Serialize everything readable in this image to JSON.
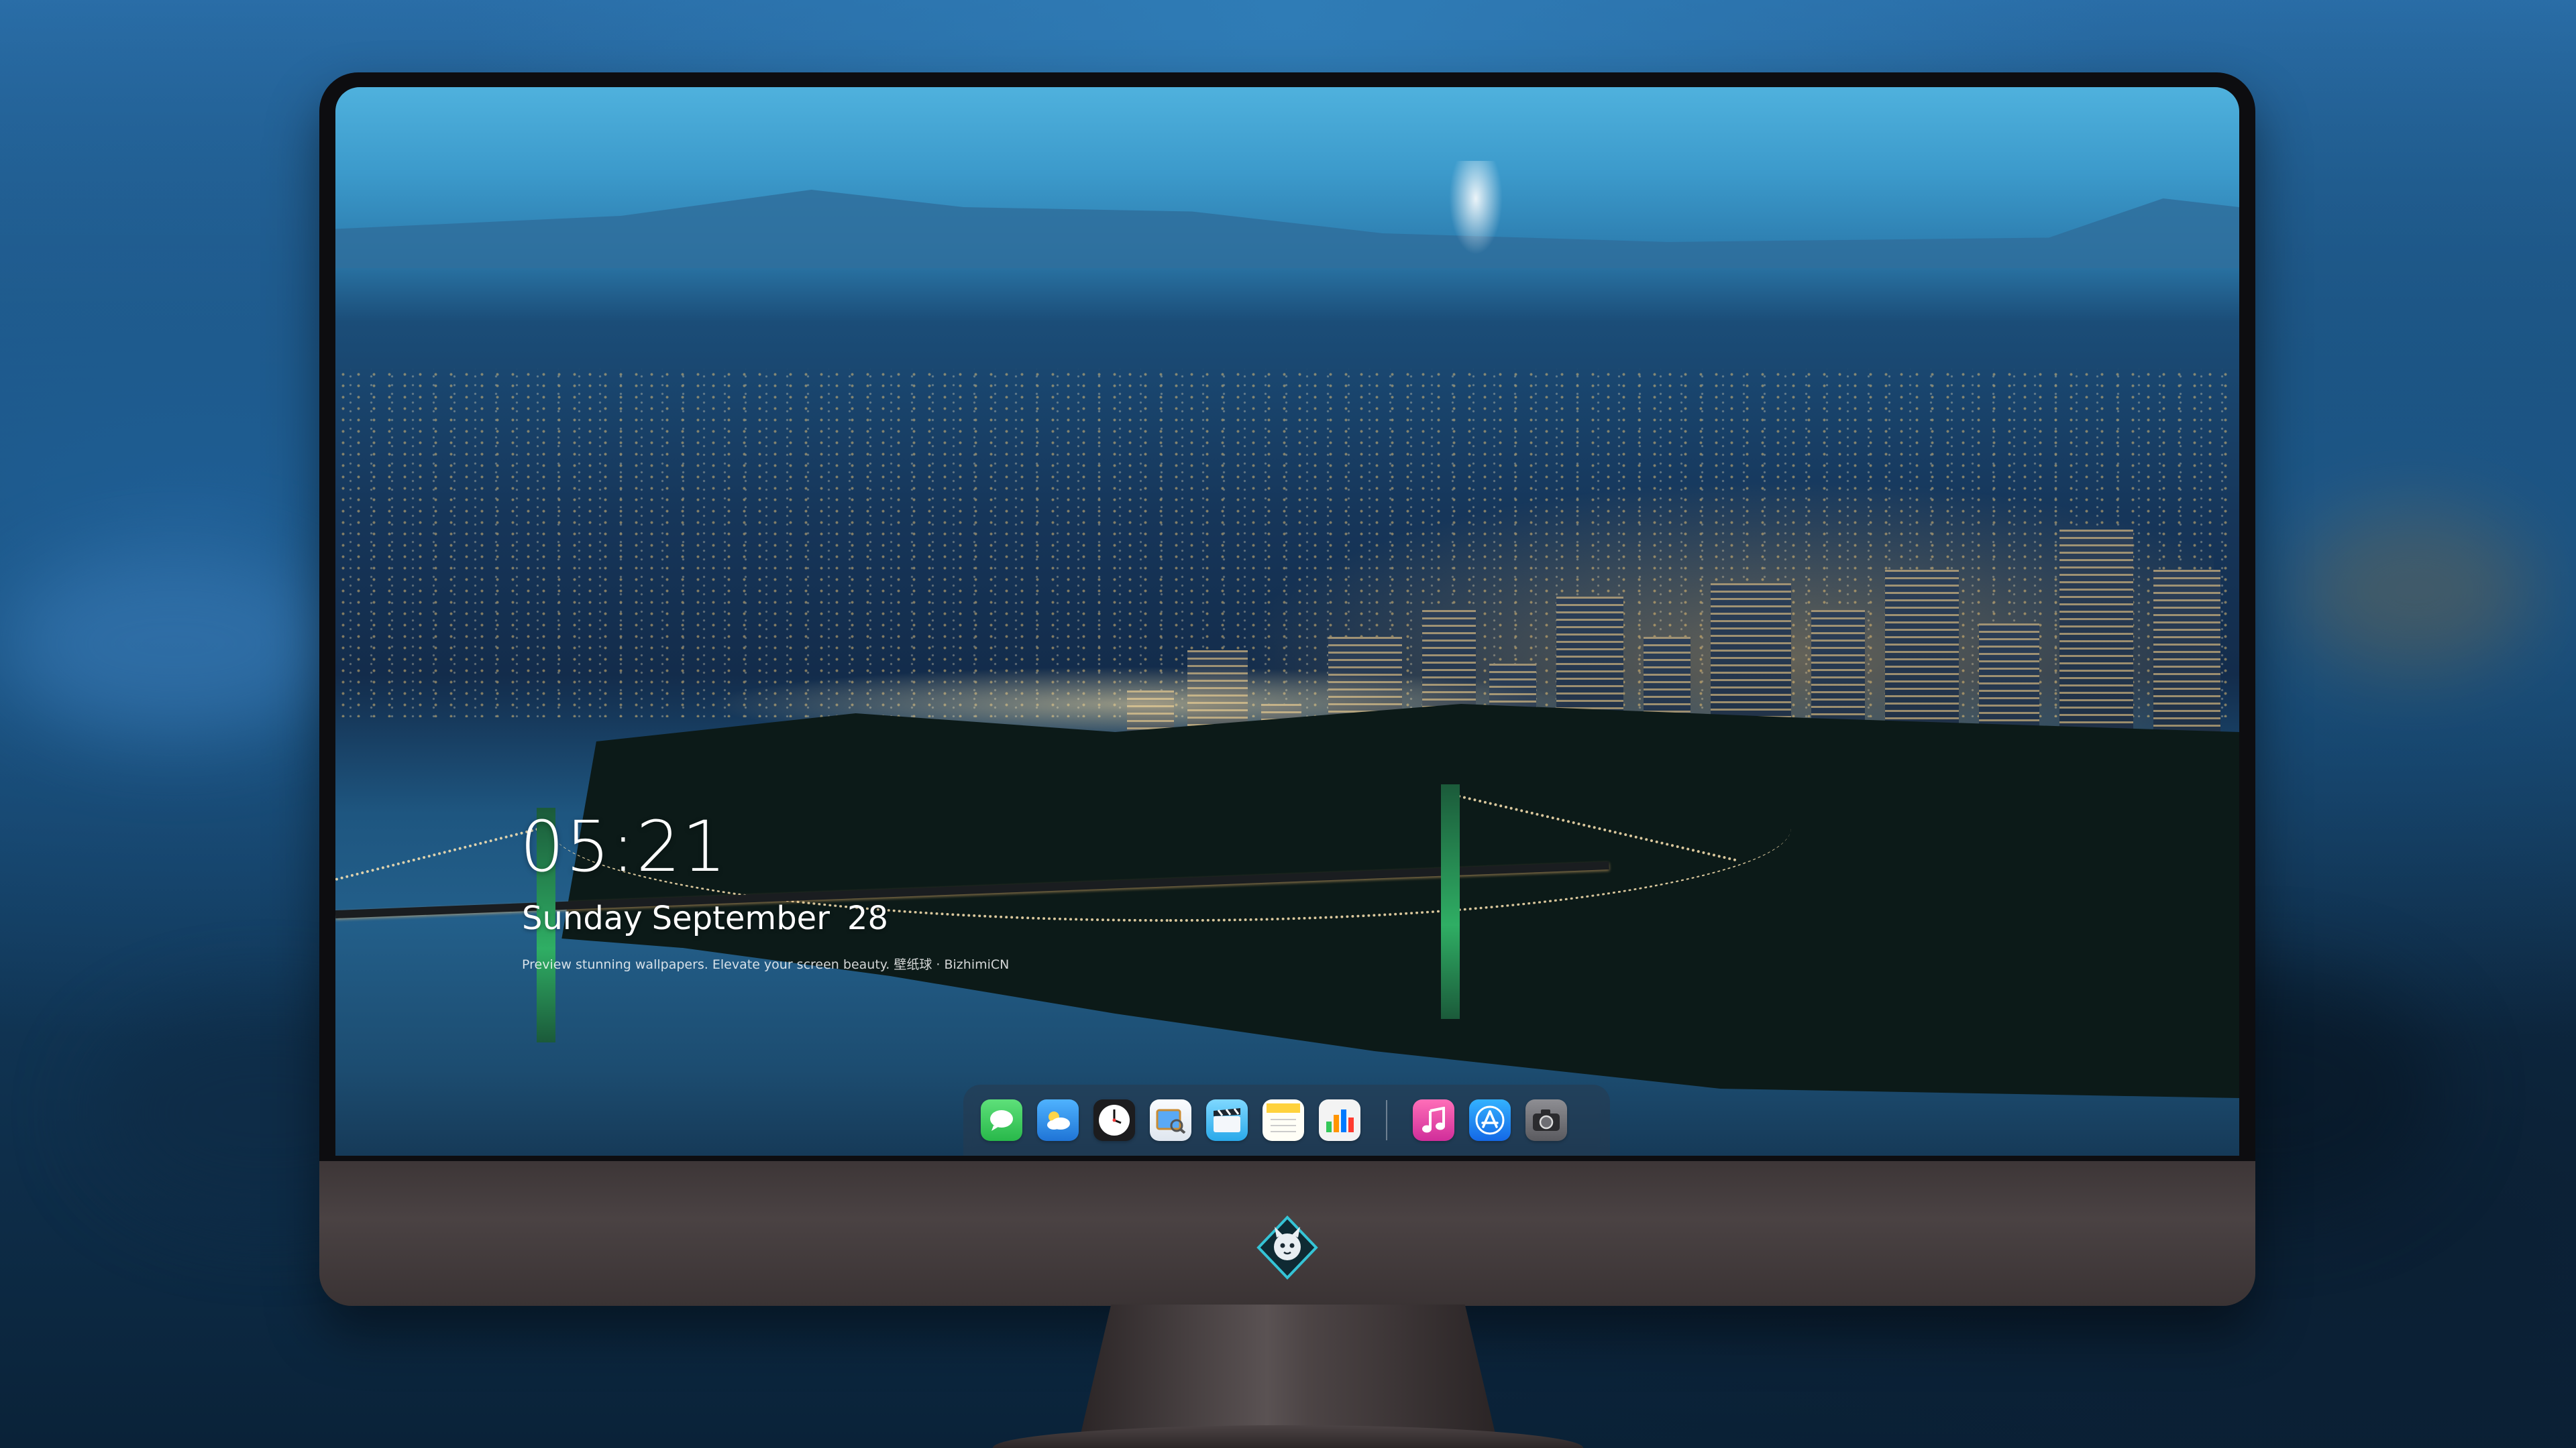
{
  "lock_screen": {
    "time": "05:21",
    "weekday": "Sunday",
    "month": "September",
    "day": "28",
    "tagline": "Preview stunning wallpapers. Elevate your screen beauty. 壁纸球 · BizhimiCN"
  },
  "dock": {
    "apps": [
      {
        "name": "messages-icon",
        "color": "#34c759",
        "glyph": "💬"
      },
      {
        "name": "weather-icon",
        "color": "#2f8fe8",
        "glyph": "⛅"
      },
      {
        "name": "clock-icon",
        "color": "#1c1c1e",
        "glyph": "🕐"
      },
      {
        "name": "preview-icon",
        "color": "#e9eef5",
        "glyph": "🖼"
      },
      {
        "name": "clips-icon",
        "color": "#55c8ff",
        "glyph": "🎬"
      },
      {
        "name": "notes-icon",
        "color": "#ffd23c",
        "glyph": "📝"
      },
      {
        "name": "numbers-icon",
        "color": "#f2f2f2",
        "glyph": "📊"
      },
      {
        "name": "music-icon",
        "color": "#fa3e9a",
        "glyph": "♫"
      },
      {
        "name": "app-store-icon",
        "color": "#1a8cff",
        "glyph": "Ⓐ"
      },
      {
        "name": "camera-icon",
        "color": "#6e6e73",
        "glyph": "📷"
      }
    ]
  },
  "monitor": {
    "logo": "brand-mascot-icon"
  }
}
